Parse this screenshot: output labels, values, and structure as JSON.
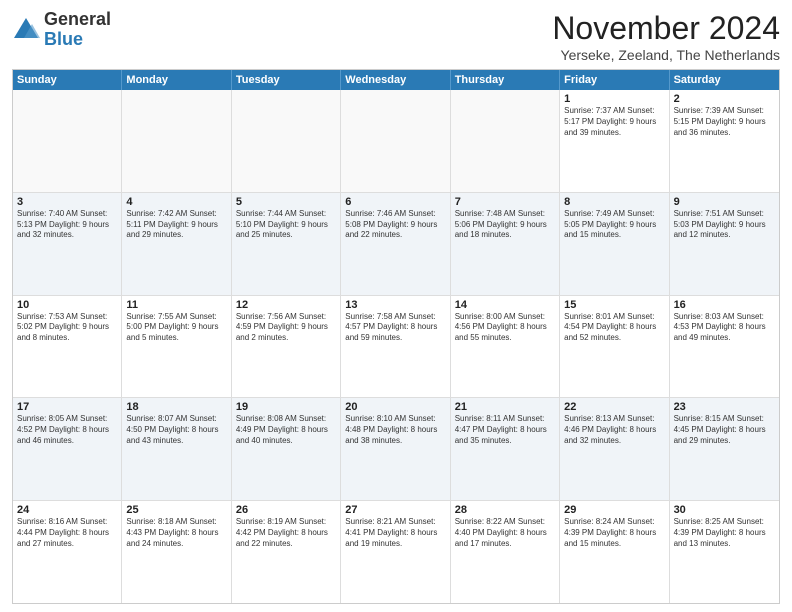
{
  "logo": {
    "general": "General",
    "blue": "Blue"
  },
  "header": {
    "month": "November 2024",
    "location": "Yerseke, Zeeland, The Netherlands"
  },
  "days": [
    "Sunday",
    "Monday",
    "Tuesday",
    "Wednesday",
    "Thursday",
    "Friday",
    "Saturday"
  ],
  "rows": [
    [
      {
        "day": "",
        "content": ""
      },
      {
        "day": "",
        "content": ""
      },
      {
        "day": "",
        "content": ""
      },
      {
        "day": "",
        "content": ""
      },
      {
        "day": "",
        "content": ""
      },
      {
        "day": "1",
        "content": "Sunrise: 7:37 AM\nSunset: 5:17 PM\nDaylight: 9 hours and 39 minutes."
      },
      {
        "day": "2",
        "content": "Sunrise: 7:39 AM\nSunset: 5:15 PM\nDaylight: 9 hours and 36 minutes."
      }
    ],
    [
      {
        "day": "3",
        "content": "Sunrise: 7:40 AM\nSunset: 5:13 PM\nDaylight: 9 hours and 32 minutes."
      },
      {
        "day": "4",
        "content": "Sunrise: 7:42 AM\nSunset: 5:11 PM\nDaylight: 9 hours and 29 minutes."
      },
      {
        "day": "5",
        "content": "Sunrise: 7:44 AM\nSunset: 5:10 PM\nDaylight: 9 hours and 25 minutes."
      },
      {
        "day": "6",
        "content": "Sunrise: 7:46 AM\nSunset: 5:08 PM\nDaylight: 9 hours and 22 minutes."
      },
      {
        "day": "7",
        "content": "Sunrise: 7:48 AM\nSunset: 5:06 PM\nDaylight: 9 hours and 18 minutes."
      },
      {
        "day": "8",
        "content": "Sunrise: 7:49 AM\nSunset: 5:05 PM\nDaylight: 9 hours and 15 minutes."
      },
      {
        "day": "9",
        "content": "Sunrise: 7:51 AM\nSunset: 5:03 PM\nDaylight: 9 hours and 12 minutes."
      }
    ],
    [
      {
        "day": "10",
        "content": "Sunrise: 7:53 AM\nSunset: 5:02 PM\nDaylight: 9 hours and 8 minutes."
      },
      {
        "day": "11",
        "content": "Sunrise: 7:55 AM\nSunset: 5:00 PM\nDaylight: 9 hours and 5 minutes."
      },
      {
        "day": "12",
        "content": "Sunrise: 7:56 AM\nSunset: 4:59 PM\nDaylight: 9 hours and 2 minutes."
      },
      {
        "day": "13",
        "content": "Sunrise: 7:58 AM\nSunset: 4:57 PM\nDaylight: 8 hours and 59 minutes."
      },
      {
        "day": "14",
        "content": "Sunrise: 8:00 AM\nSunset: 4:56 PM\nDaylight: 8 hours and 55 minutes."
      },
      {
        "day": "15",
        "content": "Sunrise: 8:01 AM\nSunset: 4:54 PM\nDaylight: 8 hours and 52 minutes."
      },
      {
        "day": "16",
        "content": "Sunrise: 8:03 AM\nSunset: 4:53 PM\nDaylight: 8 hours and 49 minutes."
      }
    ],
    [
      {
        "day": "17",
        "content": "Sunrise: 8:05 AM\nSunset: 4:52 PM\nDaylight: 8 hours and 46 minutes."
      },
      {
        "day": "18",
        "content": "Sunrise: 8:07 AM\nSunset: 4:50 PM\nDaylight: 8 hours and 43 minutes."
      },
      {
        "day": "19",
        "content": "Sunrise: 8:08 AM\nSunset: 4:49 PM\nDaylight: 8 hours and 40 minutes."
      },
      {
        "day": "20",
        "content": "Sunrise: 8:10 AM\nSunset: 4:48 PM\nDaylight: 8 hours and 38 minutes."
      },
      {
        "day": "21",
        "content": "Sunrise: 8:11 AM\nSunset: 4:47 PM\nDaylight: 8 hours and 35 minutes."
      },
      {
        "day": "22",
        "content": "Sunrise: 8:13 AM\nSunset: 4:46 PM\nDaylight: 8 hours and 32 minutes."
      },
      {
        "day": "23",
        "content": "Sunrise: 8:15 AM\nSunset: 4:45 PM\nDaylight: 8 hours and 29 minutes."
      }
    ],
    [
      {
        "day": "24",
        "content": "Sunrise: 8:16 AM\nSunset: 4:44 PM\nDaylight: 8 hours and 27 minutes."
      },
      {
        "day": "25",
        "content": "Sunrise: 8:18 AM\nSunset: 4:43 PM\nDaylight: 8 hours and 24 minutes."
      },
      {
        "day": "26",
        "content": "Sunrise: 8:19 AM\nSunset: 4:42 PM\nDaylight: 8 hours and 22 minutes."
      },
      {
        "day": "27",
        "content": "Sunrise: 8:21 AM\nSunset: 4:41 PM\nDaylight: 8 hours and 19 minutes."
      },
      {
        "day": "28",
        "content": "Sunrise: 8:22 AM\nSunset: 4:40 PM\nDaylight: 8 hours and 17 minutes."
      },
      {
        "day": "29",
        "content": "Sunrise: 8:24 AM\nSunset: 4:39 PM\nDaylight: 8 hours and 15 minutes."
      },
      {
        "day": "30",
        "content": "Sunrise: 8:25 AM\nSunset: 4:39 PM\nDaylight: 8 hours and 13 minutes."
      }
    ]
  ]
}
